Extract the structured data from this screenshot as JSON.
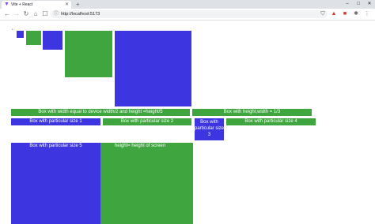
{
  "browser": {
    "tab_title": "Vite + React",
    "new_tab": "+",
    "url": "http://localhost:5173",
    "window_controls": [
      "–",
      "□",
      "✕"
    ],
    "icons": [
      "back-arrow-icon",
      "forward-arrow-icon",
      "reload-icon",
      "home-icon",
      "bookmark-icon",
      "info-icon",
      "shield-icon",
      "warning-icon",
      "pdf-icon",
      "puzzle-icon",
      "menu-icon"
    ]
  },
  "page": {
    "tiny_marker": "*",
    "labels": {
      "half_width": "Box with width equal to device width/2 and height =height/5",
      "third": "Box with height,width = 1/3",
      "size1": "Box with particular size 1",
      "size2": "Box with particular size 2",
      "size3": "Box with particular size 3",
      "size4": "Box with particular size 4",
      "size5": "Box with particular size 5",
      "screen": "height= height of screen"
    },
    "colors": {
      "blue": "#3d36e0",
      "green": "#3fa63f"
    }
  }
}
